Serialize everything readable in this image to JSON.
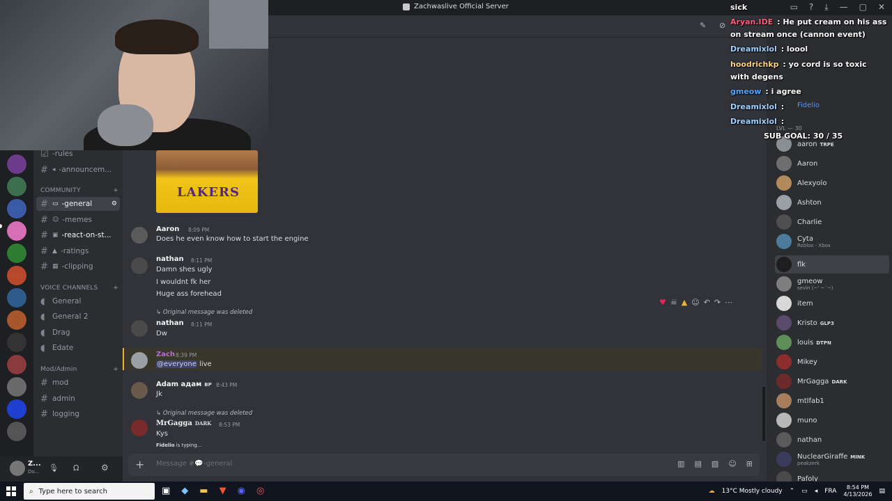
{
  "window": {
    "title": "Zachwaslive Official Server",
    "controls": [
      "—",
      "▢",
      "✕"
    ]
  },
  "channels": {
    "top": [
      {
        "name": "-rules",
        "icon": "rules-icon"
      },
      {
        "name": "-announcem...",
        "icon": "megaphone-icon"
      }
    ],
    "community_label": "COMMUNITY",
    "community": [
      {
        "name": "-general",
        "active": true
      },
      {
        "name": "-memes"
      },
      {
        "name": "-react-on-st..."
      },
      {
        "name": "-ratings"
      },
      {
        "name": "-clipping"
      }
    ],
    "voice_label": "VOICE CHANNELS",
    "voice": [
      "General",
      "General 2",
      "Drag",
      "Edate"
    ],
    "mod_label": "Mod/Admin",
    "mod": [
      "mod",
      "admin",
      "logging"
    ]
  },
  "user": {
    "name": "Z...",
    "status": "Do..."
  },
  "messages": [
    {
      "author": "Aaron",
      "time": "8:09 PM",
      "lines": [
        "Does he even know how to start the engine"
      ]
    },
    {
      "author": "nathan",
      "time": "8:11 PM",
      "lines": [
        "Damn shes ugly",
        "I wouldnt fk her",
        "Huge ass forehead"
      ]
    },
    {
      "deleted_note": "Original message was deleted",
      "author": "nathan",
      "time": "8:11 PM",
      "lines": [
        "Dw"
      ]
    },
    {
      "author": "Zach",
      "time": "8:39 PM",
      "mention": "@everyone",
      "text_after": " live"
    },
    {
      "author": "Adam адам",
      "badge": "BP",
      "time": "8:43 PM",
      "lines": [
        "Jk"
      ]
    },
    {
      "deleted_note": "Original message was deleted",
      "author": "MrGagga",
      "badge": "DARK",
      "time": "8:53 PM",
      "lines": [
        "Kys"
      ]
    }
  ],
  "typing": {
    "user": "Fidelio",
    "text": " is typing..."
  },
  "composer": {
    "placeholder": "Message #💬-general"
  },
  "embed": {
    "caption": "LAKERS"
  },
  "members": [
    {
      "name": "aaron",
      "tag": "TRPE",
      "color": "#8a8f94"
    },
    {
      "name": "Aaron",
      "color": "#6e6e6e"
    },
    {
      "name": "Alexyolo",
      "color": "#b38a5c"
    },
    {
      "name": "Ashton",
      "color": "#9aa0a6"
    },
    {
      "name": "Charlie",
      "color": "#4f4f4f"
    },
    {
      "name": "Cyta",
      "sub": "Roblox - Xbox",
      "color": "#4d7b9c"
    },
    {
      "name": "flk",
      "color": "#1e1e1e",
      "hover": true
    },
    {
      "name": "gmeow",
      "sub": "sevin (~' ~`~)",
      "color": "#7e7e7e"
    },
    {
      "name": "item",
      "color": "#d8d8d8"
    },
    {
      "name": "Kristo",
      "tag": "GLP3",
      "color": "#5b4a6b"
    },
    {
      "name": "louis",
      "tag": "DTPN",
      "color": "#5e8f58"
    },
    {
      "name": "Mikey",
      "color": "#8c2d2d"
    },
    {
      "name": "MrGagga",
      "tag": "DARK",
      "color": "#6c2a2a"
    },
    {
      "name": "mtlfab1",
      "color": "#a67e5e"
    },
    {
      "name": "muno",
      "color": "#b8b8b8"
    },
    {
      "name": "nathan",
      "color": "#5a5a5a"
    },
    {
      "name": "NuclearGiraffe",
      "tag": "MINK",
      "sub": "peakzerk",
      "color": "#3b3b5b"
    },
    {
      "name": "Pafoly",
      "color": "#4a4a4a"
    }
  ],
  "overlay": {
    "streamer": "sick",
    "lines": [
      {
        "user": "Aryan.IDE",
        "user_color": "#ff5a7a",
        "text": " : He put cream on his ass on stream once (cannon event)"
      },
      {
        "user": "Dreamixlol",
        "user_color": "#9fd1ff",
        "text": " : loool"
      },
      {
        "user": "hoodrichkp",
        "user_color": "#ffd37a",
        "text": " : yo cord is so toxic with degens"
      },
      {
        "user": "gmeow",
        "user_color": "#58a6ff",
        "text": " : i agree"
      },
      {
        "user": "Dreamixlol",
        "user_color": "#9fd1ff",
        "text": " :"
      },
      {
        "user": "Dreamixlol",
        "user_color": "#9fd1ff",
        "text": " :"
      }
    ],
    "subgoal": "SUB GOAL: 30 / 35"
  },
  "member_headers": {
    "fidelio": "Fidelio",
    "lvl": "LVL — 30"
  },
  "taskbar": {
    "search_placeholder": "Type here to search",
    "weather": "13°C  Mostly cloudy",
    "lang": "FRA",
    "time": "8:54 PM",
    "date": "4/13/2026"
  },
  "colors": {
    "accent": "#5865f2",
    "highlight": "#f0b232"
  }
}
